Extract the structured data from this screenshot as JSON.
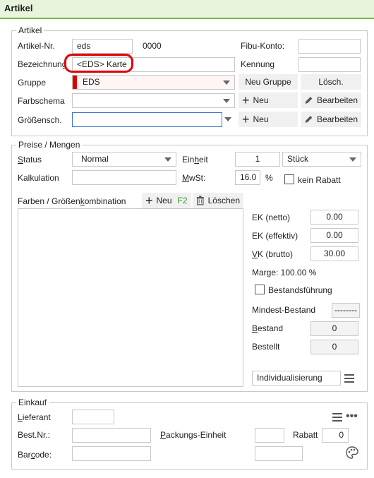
{
  "window": {
    "title": "Artikel"
  },
  "artikel": {
    "legend": "Artikel",
    "nr_label": "Artikel-Nr.",
    "nr_value": "eds",
    "nr_code": "0000",
    "fibu_label": "Fibu-Konto:",
    "bezeichnung_label": "Bezeichnung",
    "bezeichnung_value": "<EDS> Karte",
    "kennung_label": "Kennung",
    "gruppe_label": "Gruppe",
    "gruppe_value": "EDS",
    "neu_gruppe": "Neu Gruppe",
    "loesch": "Lösch.",
    "farbschema_label": "Farbschema",
    "groessensch_label": "Größensch.",
    "neu": "Neu",
    "bearbeiten": "Bearbeiten"
  },
  "preise": {
    "legend": "Preise / Mengen",
    "status_label": "Status",
    "status_value": "Normal",
    "einheit_label": "Einheit",
    "einheit_qty": "1",
    "einheit_unit": "Stück",
    "kalkulation_label": "Kalkulation",
    "mwst_label": "MwSt:",
    "mwst_value": "16.0",
    "percent": "%",
    "kein_rabatt": "kein Rabatt",
    "farben_label": "Farben / Größenkombination",
    "neu": "Neu",
    "neu_shortcut": "F2",
    "loeschen": "Löschen",
    "ek_netto_label": "EK (netto)",
    "ek_netto": "0.00",
    "ek_eff_label": "EK (effektiv)",
    "ek_eff": "0.00",
    "vk_label": "VK (brutto)",
    "vk": "30.00",
    "marge": "Marge: 100.00 %",
    "bestand_fuehrung": "Bestandsführung",
    "mindest_label": "Mindest-Bestand",
    "mindest_value": "--------",
    "bestand_label": "Bestand",
    "bestand_value": "0",
    "bestellt_label": "Bestellt",
    "bestellt_value": "0",
    "individual": "Individualisierung"
  },
  "einkauf": {
    "legend": "Einkauf",
    "lieferant_label": "Lieferant",
    "bestnr_label": "Best.Nr.:",
    "packung_label": "Packungs-Einheit",
    "rabatt_label": "Rabatt",
    "rabatt_value": "0",
    "barcode_label": "Barcode:"
  },
  "colors": {
    "accent_green": "#7ab648",
    "group_red": "#e00000",
    "highlight_red": "#e00000"
  }
}
